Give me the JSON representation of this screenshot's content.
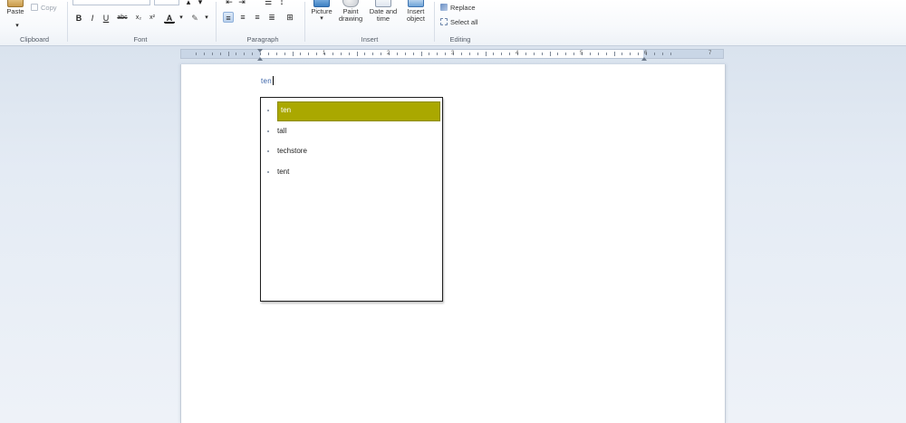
{
  "ribbon": {
    "clipboard": {
      "label": "Clipboard",
      "paste_label": "Paste",
      "copy_label": "Copy"
    },
    "font": {
      "label": "Font",
      "bold": "B",
      "italic": "I",
      "underline": "U",
      "strike": "abc",
      "superscript": "x²",
      "subscript": "x₂",
      "color": "A"
    },
    "paragraph": {
      "label": "Paragraph"
    },
    "insert": {
      "label": "Insert",
      "picture_label": "Picture",
      "paint_label": "Paint drawing",
      "datetime_label": "Date and time",
      "object_label": "Insert object"
    },
    "editing": {
      "label": "Editing",
      "replace_label": "Replace",
      "select_all_label": "Select all"
    }
  },
  "ruler": {
    "numbers": [
      "1",
      "2",
      "3",
      "4",
      "5",
      "6",
      "7"
    ]
  },
  "document": {
    "typed_text": "ten"
  },
  "autocomplete": {
    "items": [
      {
        "label": "ten",
        "selected": true
      },
      {
        "label": "tall",
        "selected": false
      },
      {
        "label": "techstore",
        "selected": false
      },
      {
        "label": "tent",
        "selected": false
      }
    ]
  },
  "colors": {
    "highlight": "#aaa800",
    "ribbon_bg": "#f7f9fc",
    "workspace_bg": "#dbe4ef",
    "popup_border": "#1f1f1f"
  }
}
